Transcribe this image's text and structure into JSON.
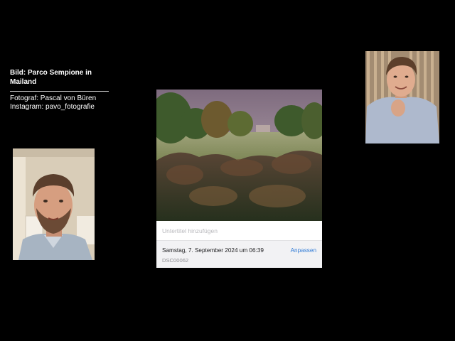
{
  "caption": {
    "title": "Bild: Parco Sempione in Mailand",
    "photographer": "Fotograf: Pascal von Büren",
    "instagram": "Instagram: pavo_fotografie"
  },
  "photo_info": {
    "subtitle_placeholder": "Untertitel hinzufügen",
    "date": "Samstag, 7. September 2024 um 06:39",
    "adjust_label": "Anpassen",
    "filename": "DSC00062"
  },
  "colors": {
    "background": "#000000",
    "accent_link": "#2f7ad6"
  }
}
